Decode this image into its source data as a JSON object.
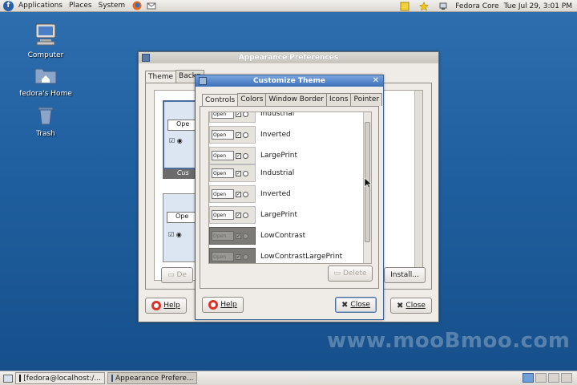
{
  "top_panel": {
    "menus": [
      "Applications",
      "Places",
      "System"
    ],
    "hostname": "Fedora Core",
    "clock": "Tue Jul 29,  3:01 PM"
  },
  "desktop": {
    "icons": [
      {
        "label": "Computer",
        "icon": "computer-icon"
      },
      {
        "label": "fedora's Home",
        "icon": "home-folder-icon"
      },
      {
        "label": "Trash",
        "icon": "trash-icon"
      }
    ]
  },
  "appearance_window": {
    "title": "Appearance Preferences",
    "tabs": [
      "Theme",
      "Backg"
    ],
    "custom_label": "Cus",
    "open_label": "Ope",
    "install_label": "Install...",
    "help_label": "Help",
    "close_label": "Close"
  },
  "customize_window": {
    "title": "Customize Theme",
    "tabs": [
      "Controls",
      "Colors",
      "Window Border",
      "Icons",
      "Pointer"
    ],
    "selected_tab": "Controls",
    "theme_rows": [
      {
        "label": "Industrial",
        "dark": false
      },
      {
        "label": "Inverted",
        "dark": false
      },
      {
        "label": "LargePrint",
        "dark": false
      },
      {
        "label": "Industrial",
        "dark": false
      },
      {
        "label": "Inverted",
        "dark": false
      },
      {
        "label": "LargePrint",
        "dark": false
      },
      {
        "label": "LowContrast",
        "dark": true
      },
      {
        "label": "LowContrastLargePrint",
        "dark": true
      }
    ],
    "thumb_button_label": "Open",
    "delete_label": "Delete",
    "help_label": "Help",
    "close_label": "Close"
  },
  "taskbar": {
    "items": [
      {
        "label": "[fedora@localhost:/...",
        "active": false
      },
      {
        "label": "Appearance Prefere...",
        "active": true
      }
    ]
  },
  "watermark": "www.mooBmoo.com",
  "colors": {
    "desktop_bg": "#1f5f9f",
    "active_titlebar": "#3b6fb8",
    "window_bg": "#efebe7"
  }
}
